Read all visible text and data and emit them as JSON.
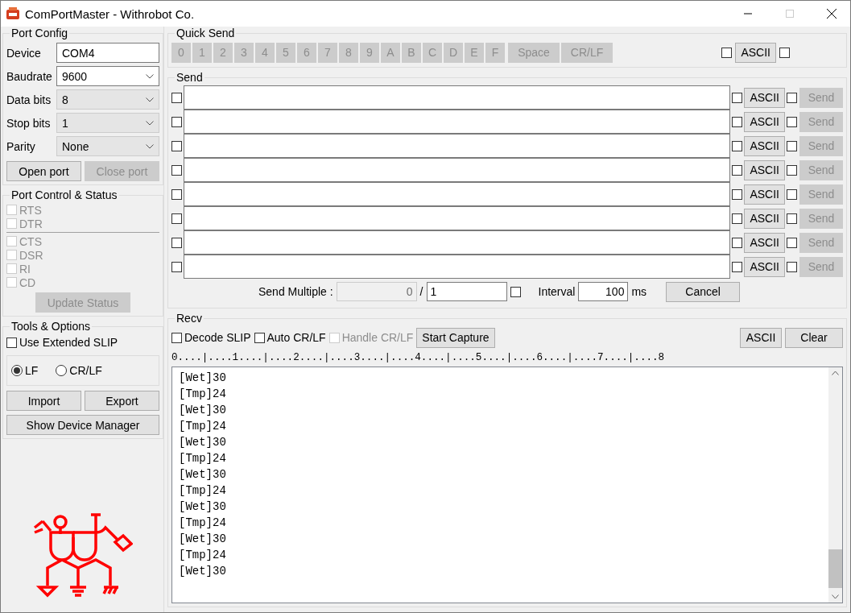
{
  "window": {
    "title": "ComPortMaster - Withrobot Co."
  },
  "port_config": {
    "title": "Port Config",
    "fields": [
      {
        "label": "Device",
        "value": "COM4",
        "kind": "text"
      },
      {
        "label": "Baudrate",
        "value": "9600",
        "kind": "combo"
      },
      {
        "label": "Data bits",
        "value": "8",
        "kind": "dropdown"
      },
      {
        "label": "Stop bits",
        "value": "1",
        "kind": "dropdown"
      },
      {
        "label": "Parity",
        "value": "None",
        "kind": "dropdown"
      }
    ],
    "buttons": [
      {
        "label": "Open port",
        "disabled": false
      },
      {
        "label": "Close port",
        "disabled": true
      }
    ]
  },
  "port_control": {
    "title": "Port Control & Status",
    "outputs": [
      {
        "label": "RTS",
        "checked": false,
        "disabled": true
      },
      {
        "label": "DTR",
        "checked": false,
        "disabled": true
      }
    ],
    "inputs": [
      {
        "label": "CTS",
        "checked": false,
        "disabled": true
      },
      {
        "label": "DSR",
        "checked": false,
        "disabled": true
      },
      {
        "label": "RI",
        "checked": false,
        "disabled": true
      },
      {
        "label": "CD",
        "checked": false,
        "disabled": true
      }
    ],
    "button": {
      "label": "Update Status",
      "disabled": true
    }
  },
  "tools": {
    "title": "Tools & Options",
    "extended_slip": {
      "label": "Use Extended SLIP",
      "checked": false
    },
    "line_ending": [
      {
        "label": "LF",
        "selected": true
      },
      {
        "label": "CR/LF",
        "selected": false
      }
    ],
    "buttons": [
      {
        "label": "Import"
      },
      {
        "label": "Export"
      },
      {
        "label": "Show Device Manager"
      }
    ]
  },
  "quick_send": {
    "title": "Quick Send",
    "keys": [
      {
        "label": "0",
        "disabled": true
      },
      {
        "label": "1",
        "disabled": true
      },
      {
        "label": "2",
        "disabled": true
      },
      {
        "label": "3",
        "disabled": true
      },
      {
        "label": "4",
        "disabled": true
      },
      {
        "label": "5",
        "disabled": true
      },
      {
        "label": "6",
        "disabled": true
      },
      {
        "label": "7",
        "disabled": true
      },
      {
        "label": "8",
        "disabled": true
      },
      {
        "label": "9",
        "disabled": true
      },
      {
        "label": "A",
        "disabled": true
      },
      {
        "label": "B",
        "disabled": true
      },
      {
        "label": "C",
        "disabled": true
      },
      {
        "label": "D",
        "disabled": true
      },
      {
        "label": "E",
        "disabled": true
      },
      {
        "label": "F",
        "disabled": true
      },
      {
        "label": "Space",
        "disabled": true
      },
      {
        "label": "CR/LF",
        "disabled": true
      }
    ],
    "left_checked": false,
    "ascii": "ASCII",
    "right_checked": false
  },
  "send": {
    "title": "Send",
    "rows": [
      {
        "checked": false,
        "ascii": "ASCII",
        "ascii_checked": false,
        "send_checked": false,
        "send": "Send",
        "send_disabled": true
      },
      {
        "checked": false,
        "ascii": "ASCII",
        "ascii_checked": false,
        "send_checked": false,
        "send": "Send",
        "send_disabled": true
      },
      {
        "checked": false,
        "ascii": "ASCII",
        "ascii_checked": false,
        "send_checked": false,
        "send": "Send",
        "send_disabled": true
      },
      {
        "checked": false,
        "ascii": "ASCII",
        "ascii_checked": false,
        "send_checked": false,
        "send": "Send",
        "send_disabled": true
      },
      {
        "checked": false,
        "ascii": "ASCII",
        "ascii_checked": false,
        "send_checked": false,
        "send": "Send",
        "send_disabled": true
      },
      {
        "checked": false,
        "ascii": "ASCII",
        "ascii_checked": false,
        "send_checked": false,
        "send": "Send",
        "send_disabled": true
      },
      {
        "checked": false,
        "ascii": "ASCII",
        "ascii_checked": false,
        "send_checked": false,
        "send": "Send",
        "send_disabled": true
      },
      {
        "checked": false,
        "ascii": "ASCII",
        "ascii_checked": false,
        "send_checked": false,
        "send": "Send",
        "send_disabled": true
      }
    ],
    "multiple": {
      "label": "Send Multiple :",
      "count": "0",
      "separator": "/",
      "total": "1",
      "checked": false,
      "interval_label": "Interval",
      "interval": "100",
      "unit": "ms",
      "cancel": "Cancel"
    }
  },
  "recv": {
    "title": "Recv",
    "options": [
      {
        "label": "Decode SLIP",
        "checked": false,
        "disabled": false
      },
      {
        "label": "Auto CR/LF",
        "checked": false,
        "disabled": false
      },
      {
        "label": "Handle CR/LF",
        "checked": false,
        "disabled": true
      }
    ],
    "capture": "Start Capture",
    "ascii": "ASCII",
    "clear": "Clear",
    "ruler": "0....|....1....|....2....|....3....|....4....|....5....|....6....|....7....|....8",
    "lines": [
      "[Wet]30",
      "[Tmp]24",
      "[Wet]30",
      "[Tmp]24",
      "[Wet]30",
      "[Tmp]24",
      "[Wet]30",
      "[Tmp]24",
      "[Wet]30",
      "[Tmp]24",
      "[Wet]30",
      "[Tmp]24",
      "[Wet]30"
    ]
  }
}
